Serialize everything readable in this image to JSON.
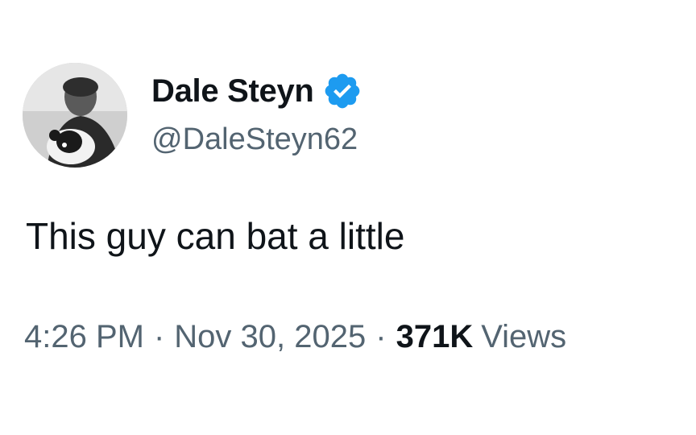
{
  "author": {
    "display_name": "Dale Steyn",
    "handle": "@DaleSteyn62",
    "verified_icon": "verified-badge-icon",
    "verified_color": "#1d9bf0"
  },
  "tweet": {
    "text": "This guy can bat a little"
  },
  "meta": {
    "time": "4:26 PM",
    "separator": "·",
    "date": "Nov 30, 2025",
    "views_count": "371K",
    "views_label": "Views"
  },
  "colors": {
    "text_primary": "#0f1419",
    "text_secondary": "#536471"
  }
}
